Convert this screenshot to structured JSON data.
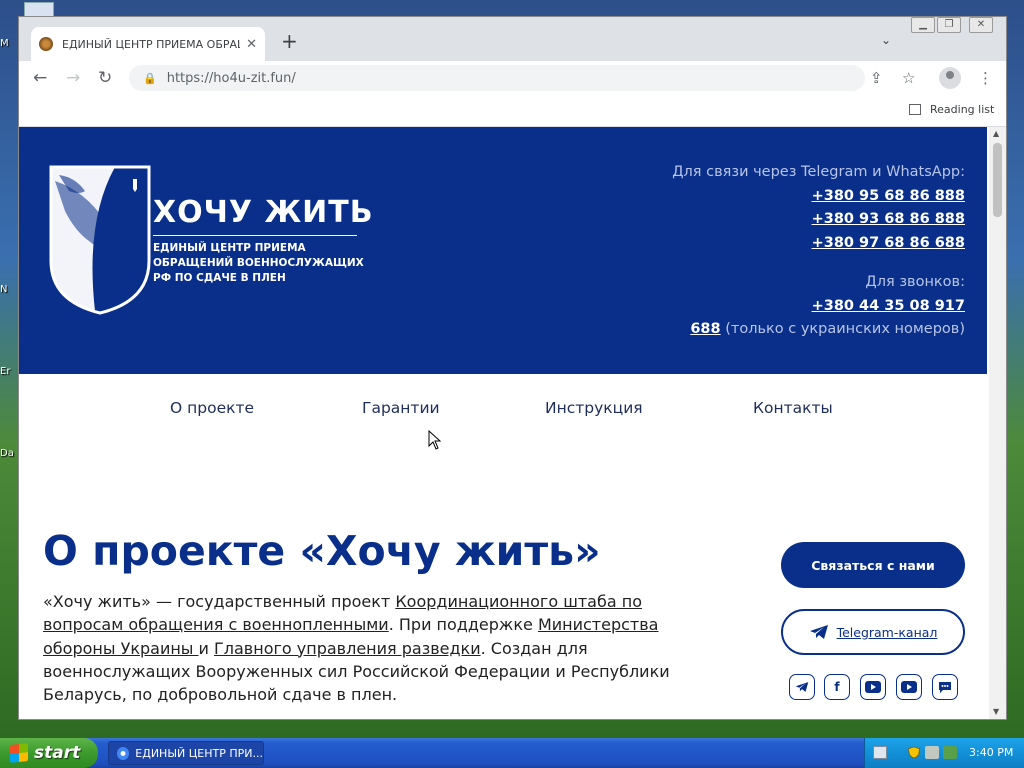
{
  "desktop": {
    "icon_labels": [
      "M",
      "N",
      "Er",
      "Da"
    ]
  },
  "browser": {
    "tab_title": "ЕДИНЫЙ ЦЕНТР ПРИЕМА ОБРАЩЕ",
    "url": "https://ho4u-zit.fun/",
    "reading_list": "Reading list"
  },
  "site": {
    "logo_title": "ХОЧУ ЖИТЬ",
    "logo_subtitle_lines": [
      "ЕДИНЫЙ ЦЕНТР ПРИЕМА",
      "ОБРАЩЕНИЙ ВОЕННОСЛУЖАЩИХ",
      "РФ ПО СДАЧЕ В ПЛЕН"
    ],
    "messenger_label": "Для связи через Telegram и WhatsApp:",
    "messenger_phones": [
      "+380 95 68 86 888",
      "+380 93 68 86 888",
      "+380 97 68 86 688"
    ],
    "calls_label": "Для звонков:",
    "call_phone": "+380 44 35 08 917",
    "short_number": "688",
    "short_note": "(только с украинских номеров)",
    "nav": [
      "О проекте",
      "Гарантии",
      "Инструкция",
      "Контакты"
    ],
    "about_title": "О проекте «Хочу жить»",
    "about": {
      "t1": "«Хочу жить» — государственный проект ",
      "l1": "Координационного штаба по вопросам обращения с военнопленными",
      "t2": ". При поддержке ",
      "l2": "Министерства обороны Украины ",
      "t3": "и ",
      "l3": "Главного управления разведки",
      "t4": ". Создан для военнослужащих Вооруженных сил Российской Федерации и Республики Беларусь, по добровольной сдаче в плен."
    },
    "contact_button": "Связаться с нами",
    "telegram_button": "Telegram-канал",
    "social_icons": [
      "telegram-icon",
      "facebook-icon",
      "youtube-icon",
      "youtube-icon",
      "chat-icon"
    ],
    "brand_color": "#0a2f8a"
  },
  "taskbar": {
    "start": "start",
    "task_label": "ЕДИНЫЙ ЦЕНТР ПРИ...",
    "clock": "3:40 PM"
  }
}
